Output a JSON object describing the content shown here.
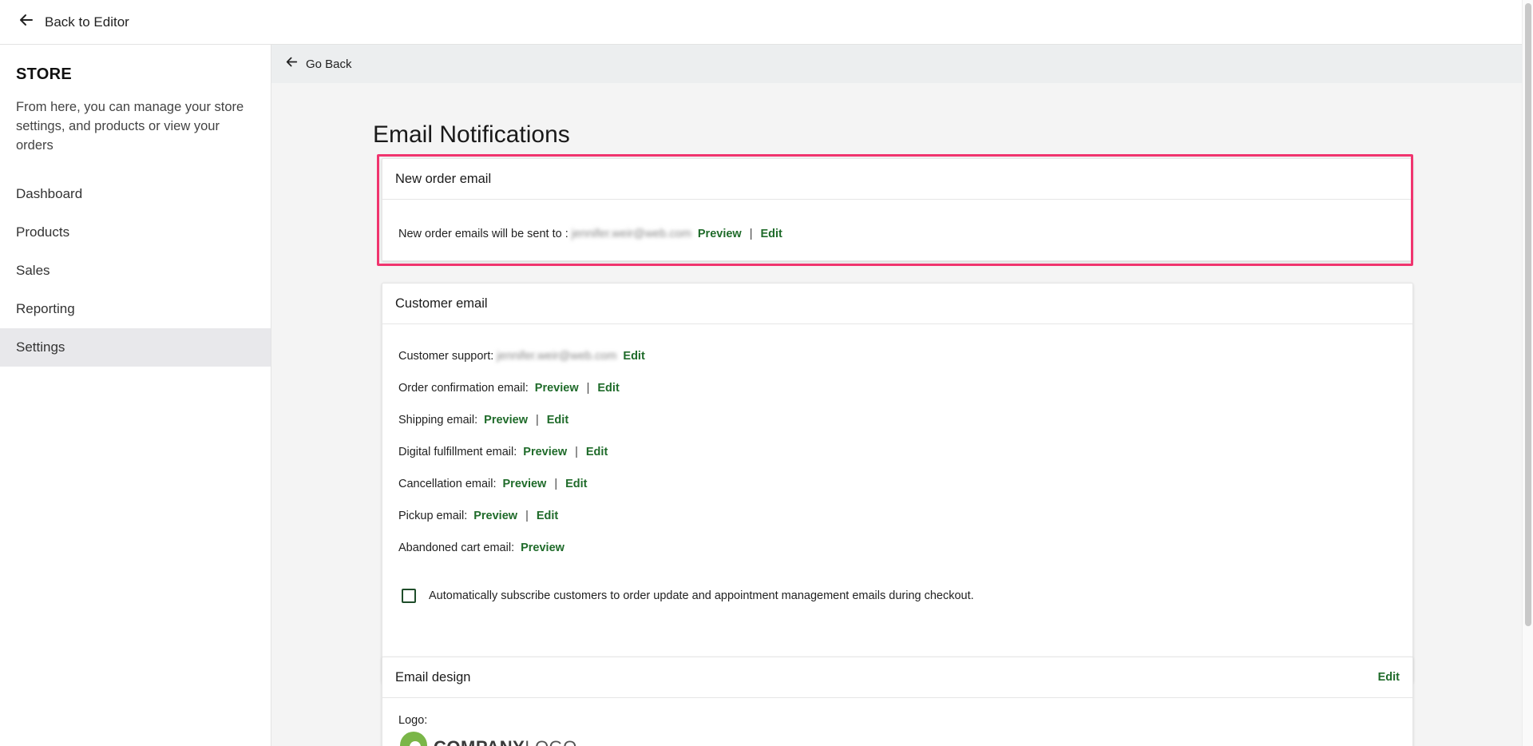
{
  "topbar": {
    "back_label": "Back to Editor"
  },
  "sidebar": {
    "title": "STORE",
    "description": "From here, you can manage your store settings, and products or view your orders",
    "items": [
      {
        "label": "Dashboard"
      },
      {
        "label": "Products"
      },
      {
        "label": "Sales"
      },
      {
        "label": "Reporting"
      },
      {
        "label": "Settings",
        "active": true
      }
    ]
  },
  "main": {
    "go_back": "Go Back",
    "page_title": "Email Notifications",
    "new_order_card": {
      "title": "New order email",
      "text": "New order emails will be sent to :",
      "email": "jennifer.weir@web.com",
      "preview": "Preview",
      "separator": "|",
      "edit": "Edit"
    },
    "customer_card": {
      "title": "Customer email",
      "support_label": "Customer support:",
      "support_email": "jennifer.weir@web.com",
      "support_edit": "Edit",
      "rows": [
        {
          "label": "Order confirmation email:",
          "preview": "Preview",
          "edit": "Edit"
        },
        {
          "label": "Shipping email:",
          "preview": "Preview",
          "edit": "Edit"
        },
        {
          "label": "Digital fulfillment email:",
          "preview": "Preview",
          "edit": "Edit"
        },
        {
          "label": "Cancellation email:",
          "preview": "Preview",
          "edit": "Edit"
        },
        {
          "label": "Pickup email:",
          "preview": "Preview",
          "edit": "Edit"
        },
        {
          "label": "Abandoned cart email:",
          "preview": "Preview"
        }
      ],
      "separator": "|",
      "checkbox_label": "Automatically subscribe customers to order update and appointment management emails during checkout."
    },
    "design_card": {
      "title": "Email design",
      "edit": "Edit",
      "logo_label": "Logo:",
      "logo_text_bold": "COMPANY",
      "logo_text_light": "LOGO"
    }
  },
  "colors": {
    "link": "#1f6b2a",
    "highlight": "#f0346e",
    "active_nav": "#e8e8eb",
    "logo_green": "#7ab648"
  }
}
